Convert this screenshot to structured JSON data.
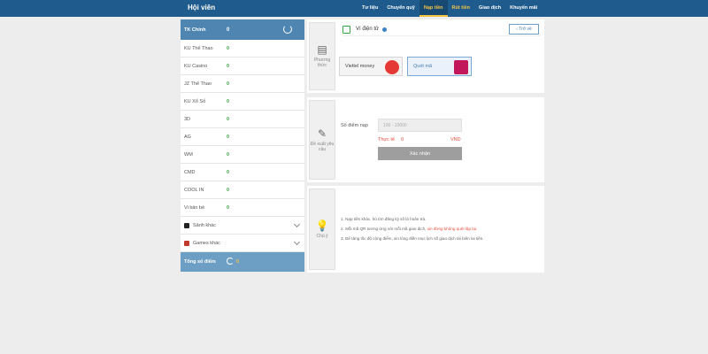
{
  "header": {
    "title": "Hội viên",
    "nav": [
      {
        "label": "Tư liệu",
        "state": "normal"
      },
      {
        "label": "Chuyển quỹ",
        "state": "normal"
      },
      {
        "label": "Nạp tiền",
        "state": "active"
      },
      {
        "label": "Rút tiền",
        "state": "gold"
      },
      {
        "label": "Giao dịch",
        "state": "normal"
      },
      {
        "label": "Khuyến mãi",
        "state": "normal"
      }
    ]
  },
  "sidebar": {
    "main": {
      "label": "TK Chính",
      "amount": "0"
    },
    "items": [
      {
        "label": "KU Thể Thao",
        "amount": "0"
      },
      {
        "label": "KU Casino",
        "amount": "0"
      },
      {
        "label": "JZ Thể Thao",
        "amount": "0"
      },
      {
        "label": "KU Xổ Số",
        "amount": "0"
      },
      {
        "label": "3D",
        "amount": "0"
      },
      {
        "label": "AG",
        "amount": "0"
      },
      {
        "label": "WM",
        "amount": "0"
      },
      {
        "label": "CMD",
        "amount": "0"
      },
      {
        "label": "COOL IN",
        "amount": "0"
      },
      {
        "label": "Vi bàn bè",
        "amount": "0"
      }
    ],
    "expandables": [
      {
        "label": "Sảnh khác"
      },
      {
        "label": "Games khác"
      }
    ],
    "total": {
      "label": "Tổng số điểm",
      "amount": "0"
    }
  },
  "step1": {
    "label": "Phương thức",
    "wallet_title": "Ví điện tử",
    "back_label": "Trở về",
    "methods": [
      {
        "label": "Viettel money"
      },
      {
        "label": "Quét mã"
      }
    ]
  },
  "step2": {
    "label": "Đề xuất yêu cầu",
    "amount_label": "Số điểm nạp",
    "amount_placeholder": "100 - 10000",
    "real_label": "Thực tế",
    "real_amount": "0",
    "real_unit": "VND",
    "confirm_label": "Xác nhận"
  },
  "step3": {
    "label": "Chú ý",
    "notes": [
      {
        "text": "1.  Nạp tiền khác, hủ tìm đăng ký số là hoàn trả.",
        "highlight": ""
      },
      {
        "text": "2.  Mỗi mã QR tương ứng với mỗi mã giao dịch, ",
        "highlight": "xin đừng không quét lập lại."
      },
      {
        "text": "3.  Để tăng tốc độ cộng điểm, xin lòng điền mục lịch số giao dịch tài biên lai tiền.",
        "highlight": ""
      }
    ]
  },
  "colors": {
    "topbar": "#1f5b8c",
    "sidebar_header": "#4f86b1",
    "accent_gold": "#f5c242",
    "positive": "#3aa842",
    "warning": "#e74c3c"
  }
}
